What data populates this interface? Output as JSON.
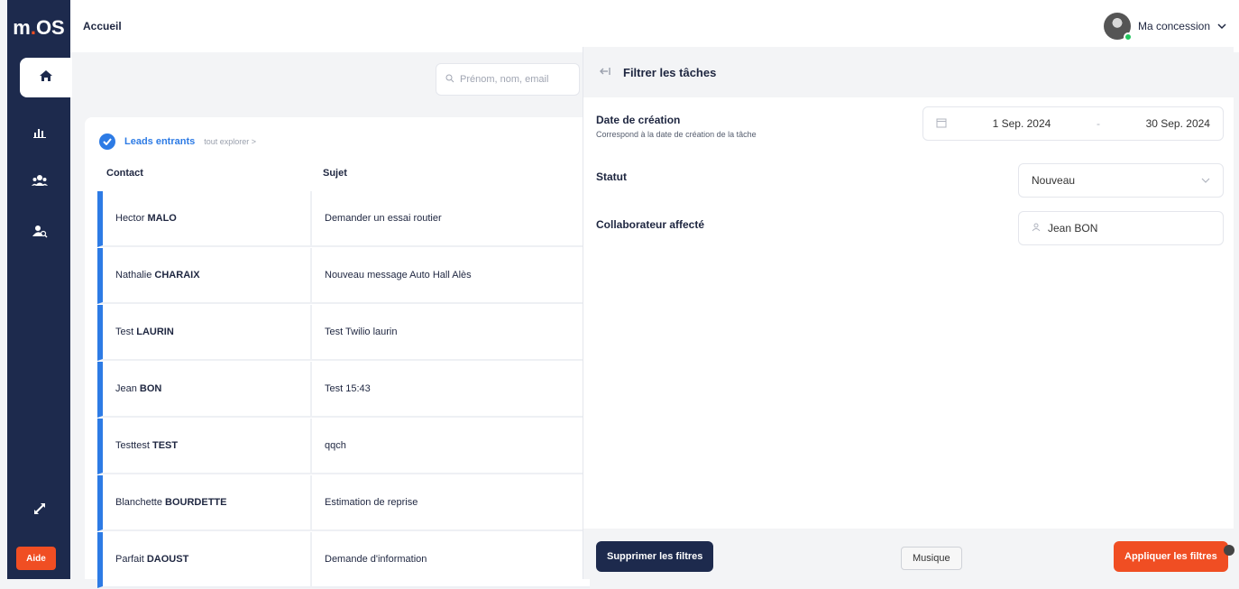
{
  "app": {
    "logo_prefix": "m",
    "logo_dot": ".",
    "logo_suffix": "OS"
  },
  "topbar": {
    "breadcrumb": "Accueil",
    "account_label": "Ma concession",
    "account_chevron": "⌄"
  },
  "sidebar": {
    "items": [
      {
        "icon": "home-icon",
        "glyph": "⌂"
      },
      {
        "icon": "chart-icon",
        "glyph": "▐"
      },
      {
        "icon": "team-icon",
        "glyph": "⚇"
      },
      {
        "icon": "user-search-icon",
        "glyph": "♟"
      }
    ],
    "bottom_icon": "↔",
    "help_label": "Aide"
  },
  "search": {
    "placeholder": "Prénom, nom, email"
  },
  "leads": {
    "title": "Leads entrants",
    "explore": "tout explorer >",
    "columns": [
      "Contact",
      "Sujet"
    ],
    "rows": [
      {
        "first": "Hector",
        "last": "MALO",
        "subject": "Demander un essai routier"
      },
      {
        "first": "Nathalie",
        "last": "CHARAIX",
        "subject": "Nouveau message Auto Hall Alès"
      },
      {
        "first": "Test",
        "last": "LAURIN",
        "subject": "Test Twilio laurin"
      },
      {
        "first": "Jean",
        "last": "BON",
        "subject": "Test 15:43"
      },
      {
        "first": "Testtest",
        "last": "TEST",
        "subject": "qqch"
      },
      {
        "first": "Blanchette",
        "last": "BOURDETTE",
        "subject": "Estimation de reprise"
      },
      {
        "first": "Parfait",
        "last": "DAOUST",
        "subject": "Demande d'information"
      }
    ]
  },
  "filter_panel": {
    "title": "Filtrer les tâches",
    "date_label": "Date de création",
    "date_sub": "Correspond à la date de création de la tâche",
    "date_from": "1 Sep. 2024",
    "date_sep": "-",
    "date_to": "30 Sep. 2024",
    "status_label": "Statut",
    "status_value": "Nouveau",
    "assignee_label": "Collaborateur affecté",
    "assignee_value": "Jean BON",
    "clear_button": "Supprimer les filtres",
    "music_button": "Musique",
    "apply_button": "Appliquer les filtres"
  }
}
